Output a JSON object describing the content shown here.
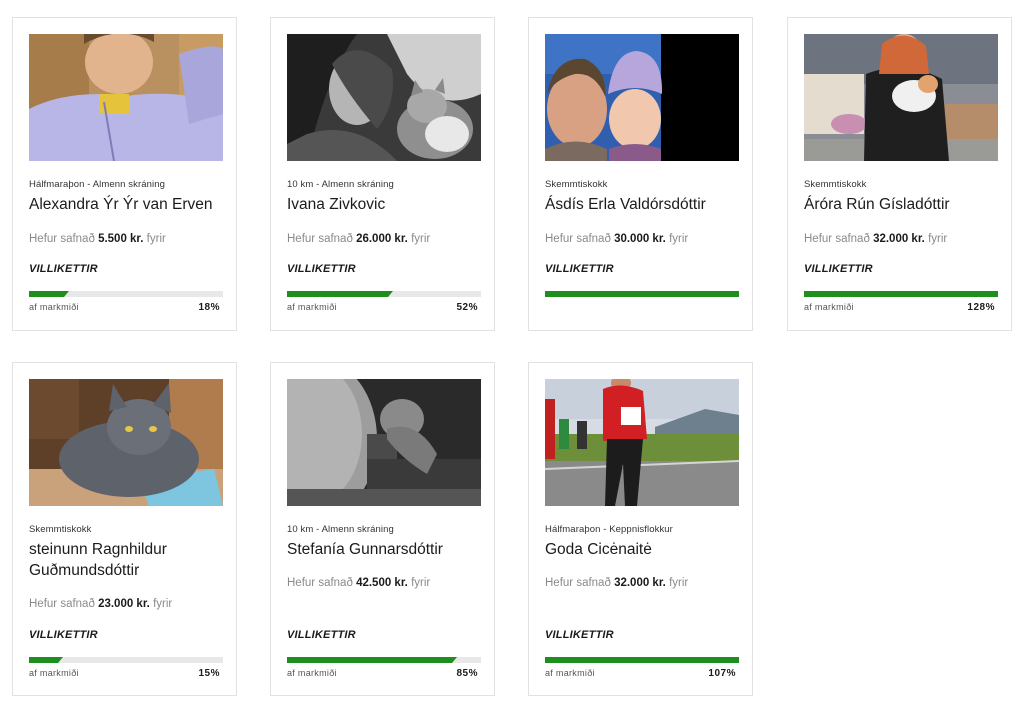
{
  "common": {
    "raised_prefix": "Hefur safnað",
    "raised_suffix": "fyrir",
    "goal_label": "af markmiði"
  },
  "colors": {
    "progress_green": "#1e8f1e",
    "progress_track": "#e8e8e8",
    "card_border": "#e2e2e2"
  },
  "runners": [
    {
      "photo": "woman-in-lavender-jacket-photo",
      "category": "Hálfmaraþon - Almenn skráning",
      "name": "Alexandra Ýr Ýr van Erven",
      "amount": "5.500 kr.",
      "team": "VILLIKETTIR",
      "progress": 0.18,
      "percent": "18%"
    },
    {
      "photo": "woman-with-cat-bw-photo",
      "category": "10 km - Almenn skráning",
      "name": "Ivana Zivkovic",
      "amount": "26.000 kr.",
      "team": "VILLIKETTIR",
      "progress": 0.52,
      "percent": "52%"
    },
    {
      "photo": "woman-and-child-selfie-photo",
      "category": "Skemmtiskokk",
      "name": "Ásdís Erla Valdórsdóttir",
      "amount": "30.000 kr.",
      "team": "VILLIKETTIR",
      "progress": 1.0,
      "percent": ""
    },
    {
      "photo": "girl-holding-cat-photo",
      "category": "Skemmtiskokk",
      "name": "Áróra Rún Gísladóttir",
      "amount": "32.000 kr.",
      "team": "VILLIKETTIR",
      "progress": 1.0,
      "percent": "128%"
    },
    {
      "photo": "grey-cat-in-box-photo",
      "category": "Skemmtiskokk",
      "name": "steinunn Ragnhildur Guðmundsdóttir",
      "amount": "23.000 kr.",
      "team": "VILLIKETTIR",
      "progress": 0.15,
      "percent": "15%"
    },
    {
      "photo": "night-trail-camera-cat-photo",
      "category": "10 km - Almenn skráning",
      "name": "Stefanía Gunnarsdóttir",
      "amount": "42.500 kr.",
      "team": "VILLIKETTIR",
      "progress": 0.85,
      "percent": "85%"
    },
    {
      "photo": "runner-in-race-photo",
      "category": "Hálfmaraþon - Keppnisflokkur",
      "name": "Goda Cicėnaitė",
      "amount": "32.000 kr.",
      "team": "VILLIKETTIR",
      "progress": 1.0,
      "percent": "107%"
    }
  ]
}
